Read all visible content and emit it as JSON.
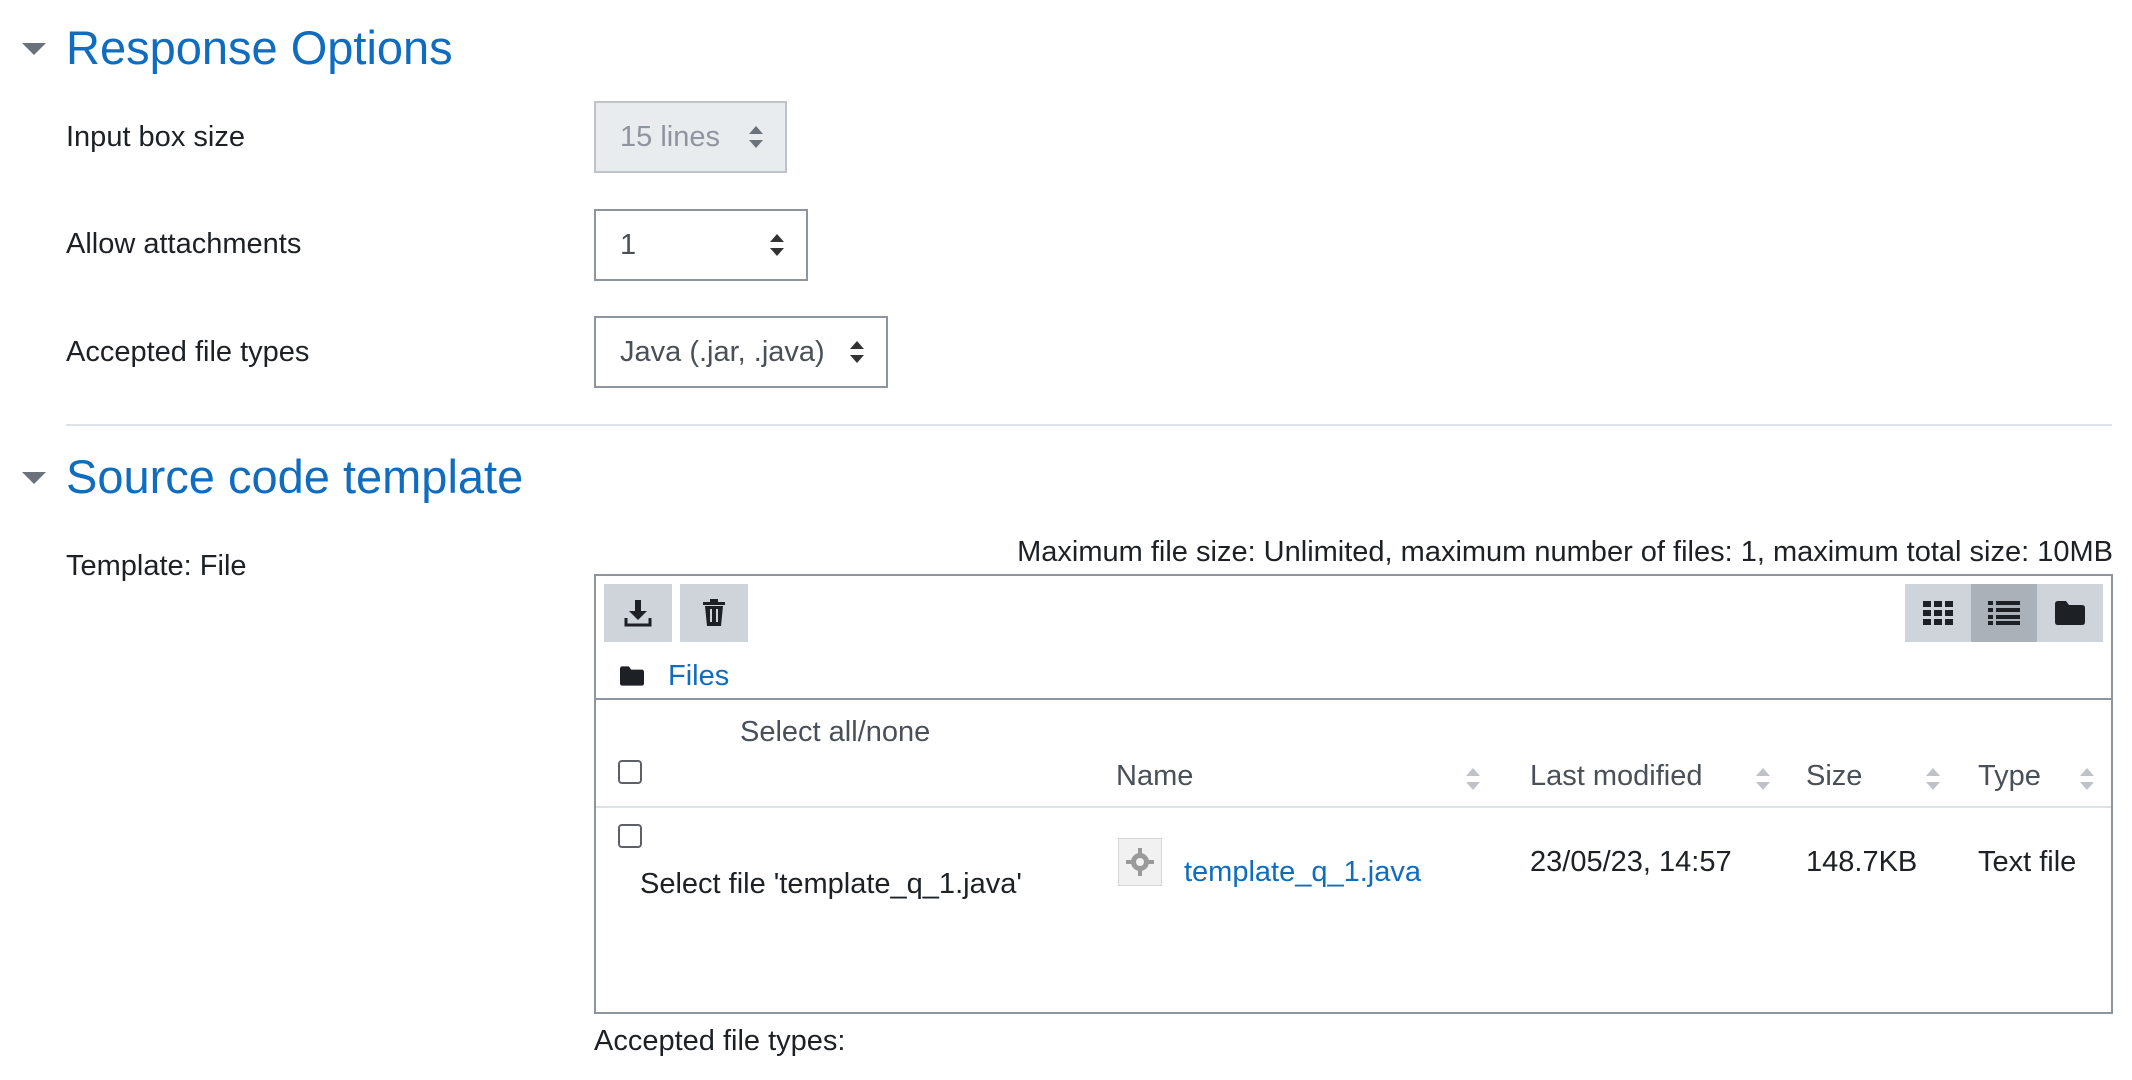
{
  "response_options": {
    "title": "Response Options",
    "input_box_size": {
      "label": "Input box size",
      "value": "15 lines"
    },
    "allow_attachments": {
      "label": "Allow attachments",
      "value": "1"
    },
    "accepted_file_types": {
      "label": "Accepted file types",
      "value": "Java (.jar, .java)"
    }
  },
  "source_code_template": {
    "title": "Source code template",
    "template_label": "Template: File",
    "limits_text": "Maximum file size: Unlimited, maximum number of files: 1, maximum total size: 10MB",
    "breadcrumb": "Files",
    "select_all_label": "Select all/none",
    "columns": {
      "name": "Name",
      "last_modified": "Last modified",
      "size": "Size",
      "type": "Type"
    },
    "files": [
      {
        "select_label": "Select file 'template_q_1.java'",
        "name": "template_q_1.java",
        "last_modified": "23/05/23, 14:57",
        "size": "148.7KB",
        "type": "Text file",
        "icon": "gear-file-icon"
      }
    ],
    "accepted_types_footer": "Accepted file types:"
  },
  "icons": {
    "download": "download-icon",
    "delete": "trash-icon",
    "view_icons": "grid-icon",
    "view_list": "list-icon",
    "view_tree": "folder-icon"
  }
}
